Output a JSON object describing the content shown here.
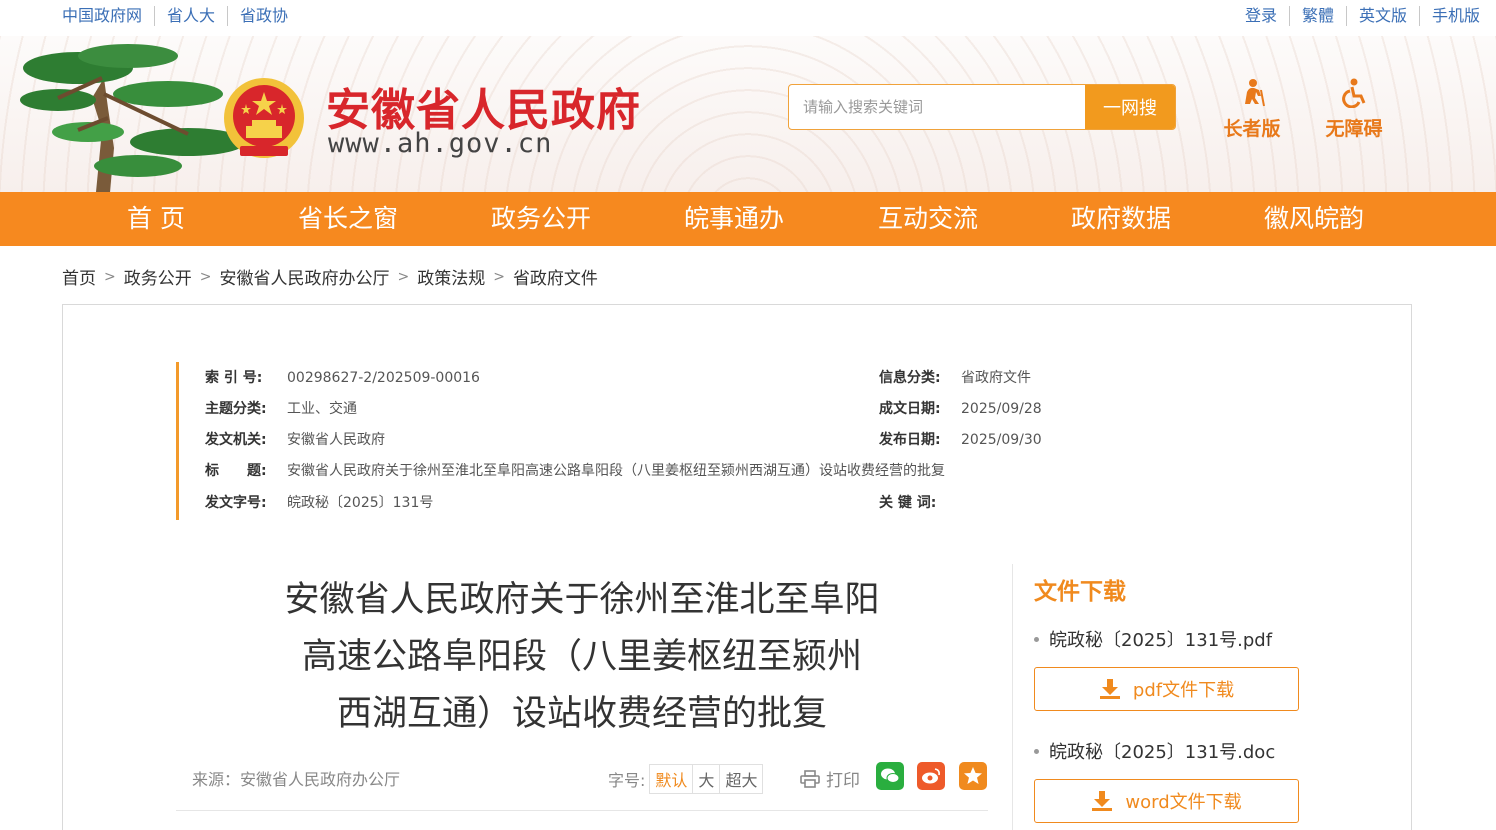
{
  "topbar": {
    "left_links": [
      "中国政府网",
      "省人大",
      "省政协"
    ],
    "right_links": [
      "登录",
      "繁體",
      "英文版",
      "手机版"
    ]
  },
  "header": {
    "site_title": "安徽省人民政府",
    "site_url": "www.ah.gov.cn",
    "search_placeholder": "请输入搜索关键词",
    "search_button": "一网搜",
    "elder_mode": "长者版",
    "accessibility": "无障碍"
  },
  "nav": [
    "首 页",
    "省长之窗",
    "政务公开",
    "皖事通办",
    "互动交流",
    "政府数据",
    "徽风皖韵"
  ],
  "breadcrumb": [
    "首页",
    "政务公开",
    "安徽省人民政府办公厅",
    "政策法规",
    "省政府文件"
  ],
  "meta": {
    "index_label": "索 引 号:",
    "index_value": "00298627-2/202509-00016",
    "category_label": "信息分类:",
    "category_value": "省政府文件",
    "topic_label": "主题分类:",
    "topic_value": "工业、交通",
    "written_label": "成文日期:",
    "written_value": "2025/09/28",
    "issuer_label": "发文机关:",
    "issuer_value": "安徽省人民政府",
    "published_label": "发布日期:",
    "published_value": "2025/09/30",
    "title_label": "标　　题:",
    "title_value": "安徽省人民政府关于徐州至淮北至阜阳高速公路阜阳段（八里姜枢纽至颍州西湖互通）设站收费经营的批复",
    "docno_label": "发文字号:",
    "docno_value": "皖政秘〔2025〕131号",
    "keywords_label": "关 键 词:",
    "keywords_value": ""
  },
  "article": {
    "title_lines": [
      "安徽省人民政府关于徐州至淮北至阜阳",
      "高速公路阜阳段（八里姜枢纽至颍州",
      "西湖互通）设站收费经营的批复"
    ],
    "source": "来源：安徽省人民政府办公厅",
    "font_label": "字号:",
    "font_options": [
      "默认",
      "大",
      "超大"
    ],
    "print_label": "打印"
  },
  "downloads": {
    "title": "文件下载",
    "files": [
      {
        "name": "皖政秘〔2025〕131号.pdf",
        "button": "pdf文件下载"
      },
      {
        "name": "皖政秘〔2025〕131号.doc",
        "button": "word文件下载"
      }
    ]
  },
  "colors": {
    "accent": "#f6891f",
    "title_red": "#d8262b",
    "link_blue": "#3b6fb6"
  }
}
